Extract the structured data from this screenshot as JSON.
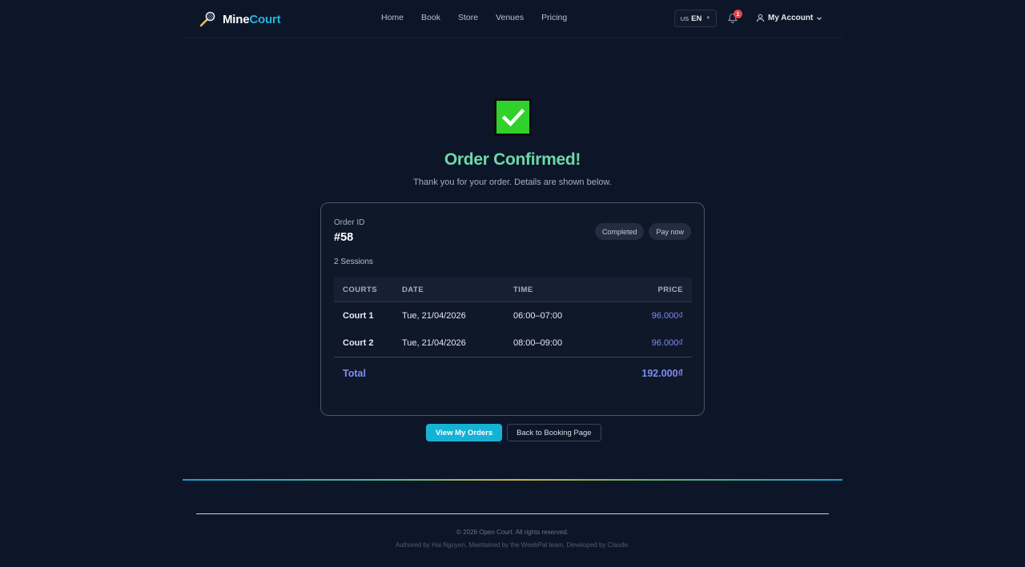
{
  "header": {
    "brand_part1": "Mine",
    "brand_part2": "Court",
    "nav": [
      "Home",
      "Book",
      "Store",
      "Venues",
      "Pricing"
    ],
    "lang_flag": "US",
    "lang_code": "EN",
    "notification_count": "1",
    "account_label": "My Account"
  },
  "main": {
    "title": "Order Confirmed!",
    "subtitle": "Thank you for your order. Details are shown below."
  },
  "order": {
    "id_label": "Order ID",
    "id_value": "#58",
    "status_badge": "Completed",
    "pay_badge": "Pay now",
    "sessions": "2 Sessions",
    "columns": [
      "COURTS",
      "DATE",
      "TIME",
      "PRICE"
    ],
    "rows": [
      {
        "court": "Court 1",
        "date": "Tue, 21/04/2026",
        "time": "06:00–07:00",
        "price": "96.000₫"
      },
      {
        "court": "Court 2",
        "date": "Tue, 21/04/2026",
        "time": "08:00–09:00",
        "price": "96.000₫"
      }
    ],
    "total_label": "Total",
    "total_value": "192.000₫"
  },
  "actions": {
    "view_orders": "View My Orders",
    "back_booking": "Back to Booking Page"
  },
  "footer": {
    "copyright": "© 2026 Open Court. All rights reserved.",
    "credits": "Authored by Hai Nguyen, Maintained by the WeebPal team, Developed by Claude."
  },
  "colors": {
    "background": "#0d1629",
    "accent": "#16b2d6",
    "success": "#6ed8a6",
    "price": "#7e8cf5",
    "check": "#2fd12a",
    "badge_alert": "#e74646"
  }
}
